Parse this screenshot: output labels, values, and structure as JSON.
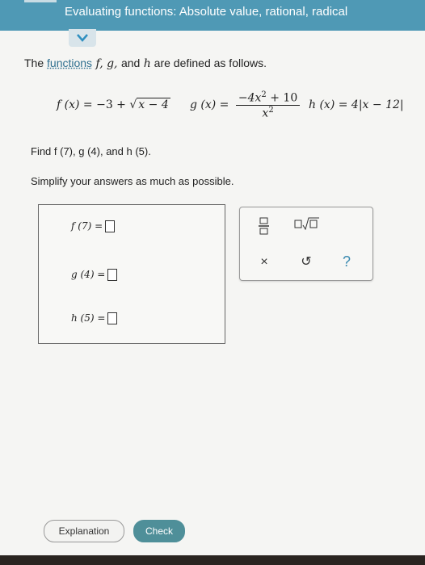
{
  "header": {
    "title": "Evaluating functions: Absolute value, rational, radical"
  },
  "intro": {
    "prefix": "The ",
    "link": "functions",
    "vars": " f, g, ",
    "and": "and",
    "h": " h",
    "suffix": " are defined as follows."
  },
  "equations": {
    "f_lhs": "f (x) = ",
    "f_rhs_before": "−3 + ",
    "f_radicand": "x − 4",
    "g_lhs": "g (x) = ",
    "g_num": "−4x",
    "g_num_exp": "2",
    "g_num_tail": " + 10",
    "g_den": "x",
    "g_den_exp": "2",
    "h_lhs": "h (x) = 4",
    "h_abs": "|x − 12|"
  },
  "instructions": {
    "find": "Find f (7), g (4), and h (5).",
    "simplify": "Simplify your answers as much as possible."
  },
  "answers": [
    {
      "label": "f (7) ="
    },
    {
      "label": "g (4) ="
    },
    {
      "label": "h (5) ="
    }
  ],
  "toolbar": {
    "fraction_icon": "fraction-icon",
    "sqrt_icon": "square-root-icon",
    "clear_symbol": "×",
    "undo_symbol": "↺",
    "help_symbol": "?"
  },
  "buttons": {
    "explanation": "Explanation",
    "check": "Check"
  },
  "colors": {
    "header": "#4f99b5",
    "check_button": "#4f8f99"
  }
}
